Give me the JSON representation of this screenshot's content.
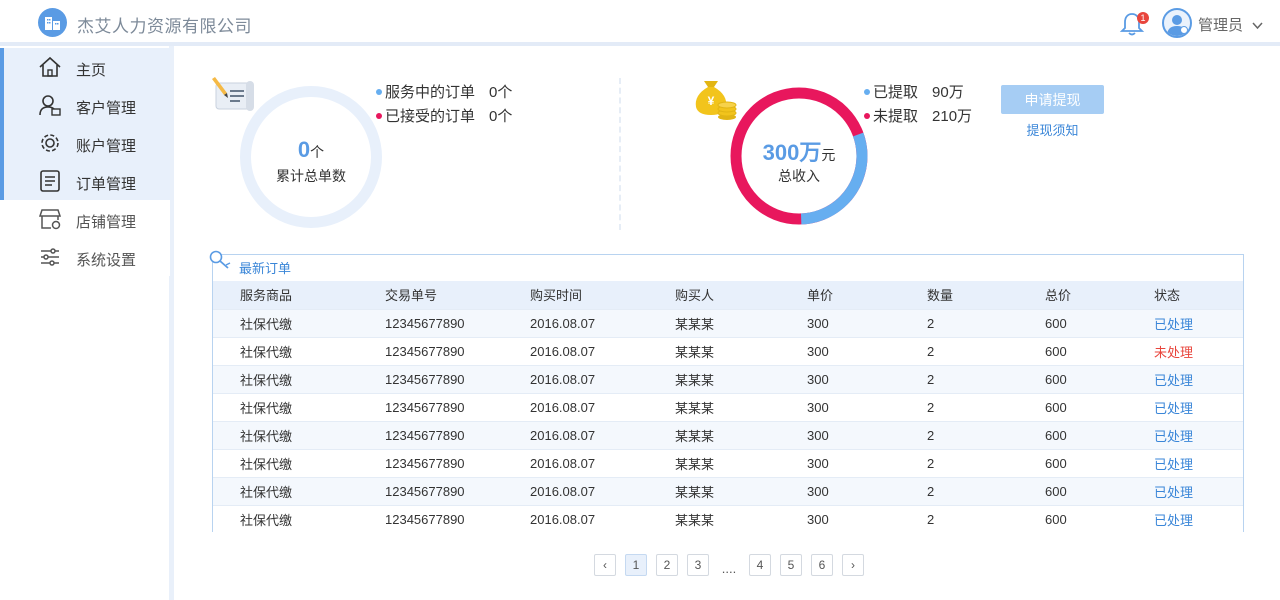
{
  "header": {
    "company": "杰艾人力资源有限公司",
    "notification_count": "1",
    "user_name": "管理员"
  },
  "sidebar": {
    "items": [
      {
        "label": "主页",
        "icon": "home-icon",
        "active": true
      },
      {
        "label": "客户管理",
        "icon": "customer-icon",
        "active": true
      },
      {
        "label": "账户管理",
        "icon": "gear-icon",
        "active": true
      },
      {
        "label": "订单管理",
        "icon": "document-icon",
        "active": true
      },
      {
        "label": "店铺管理",
        "icon": "store-icon",
        "active": false
      },
      {
        "label": "系统设置",
        "icon": "sliders-icon",
        "active": false
      }
    ]
  },
  "stats": {
    "orders": {
      "total_value": "0",
      "total_unit": "个",
      "total_label": "累计总单数",
      "in_service_label": "服务中的订单",
      "in_service_value": "0个",
      "accepted_label": "已接受的订单",
      "accepted_value": "0个"
    },
    "income": {
      "total_value": "300万",
      "total_unit": "元",
      "total_label": "总收入",
      "withdrawn_label": "已提取",
      "withdrawn_value": "90万",
      "withdrawn_amount": 90,
      "unwithdrawn_label": "未提取",
      "unwithdrawn_value": "210万",
      "unwithdrawn_amount": 210,
      "apply_button": "申请提现",
      "withdraw_note": "提现须知"
    }
  },
  "colors": {
    "accent": "#5a9be4",
    "link": "#3a86d8",
    "withdrawn": "#66aef0",
    "unwithdrawn": "#e8175d",
    "pending": "#e8453c"
  },
  "orders_table": {
    "title": "最新订单",
    "columns": [
      "服务商品",
      "交易单号",
      "购买时间",
      "购买人",
      "单价",
      "数量",
      "总价",
      "状态"
    ],
    "rows": [
      [
        "社保代缴",
        "12345677890",
        "2016.08.07",
        "某某某",
        "300",
        "2",
        "600",
        "已处理"
      ],
      [
        "社保代缴",
        "12345677890",
        "2016.08.07",
        "某某某",
        "300",
        "2",
        "600",
        "未处理"
      ],
      [
        "社保代缴",
        "12345677890",
        "2016.08.07",
        "某某某",
        "300",
        "2",
        "600",
        "已处理"
      ],
      [
        "社保代缴",
        "12345677890",
        "2016.08.07",
        "某某某",
        "300",
        "2",
        "600",
        "已处理"
      ],
      [
        "社保代缴",
        "12345677890",
        "2016.08.07",
        "某某某",
        "300",
        "2",
        "600",
        "已处理"
      ],
      [
        "社保代缴",
        "12345677890",
        "2016.08.07",
        "某某某",
        "300",
        "2",
        "600",
        "已处理"
      ],
      [
        "社保代缴",
        "12345677890",
        "2016.08.07",
        "某某某",
        "300",
        "2",
        "600",
        "已处理"
      ],
      [
        "社保代缴",
        "12345677890",
        "2016.08.07",
        "某某某",
        "300",
        "2",
        "600",
        "已处理"
      ]
    ]
  },
  "pagination": {
    "prev": "‹",
    "next": "›",
    "pages": [
      "1",
      "2",
      "3"
    ],
    "ellipsis": "....",
    "pages_after": [
      "4",
      "5",
      "6"
    ],
    "current": "1"
  }
}
